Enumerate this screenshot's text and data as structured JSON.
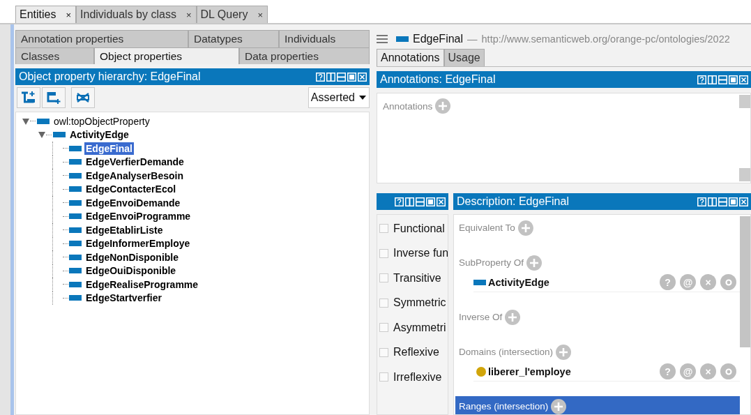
{
  "workspace_tabs": [
    {
      "label": "Entities",
      "close": "×",
      "selected": true
    },
    {
      "label": "Individuals by class",
      "close": "×",
      "selected": false
    },
    {
      "label": "DL Query",
      "close": "×",
      "selected": false
    }
  ],
  "entity_tabs": [
    [
      {
        "label": "Annotation properties",
        "selected": false
      },
      {
        "label": "Datatypes",
        "selected": false
      },
      {
        "label": "Individuals",
        "selected": false
      }
    ],
    [
      {
        "label": "Classes",
        "selected": false
      },
      {
        "label": "Object properties",
        "selected": true
      },
      {
        "label": "Data properties",
        "selected": false
      }
    ]
  ],
  "hierarchy": {
    "title": "Object property hierarchy: EdgeFinal",
    "view_mode": "Asserted",
    "tree": [
      {
        "label": "owl:topObjectProperty",
        "expanded": true,
        "selected": false,
        "children": [
          {
            "label": "ActivityEdge",
            "expanded": true,
            "selected": false,
            "children": [
              {
                "label": "EdgeFinal",
                "selected": true
              },
              {
                "label": "EdgeVerfierDemande",
                "selected": false
              },
              {
                "label": "EdgeAnalyserBesoin",
                "selected": false
              },
              {
                "label": "EdgeContacterEcol",
                "selected": false
              },
              {
                "label": "EdgeEnvoiDemande",
                "selected": false
              },
              {
                "label": "EdgeEnvoiProgramme",
                "selected": false
              },
              {
                "label": "EdgeEtablirListe",
                "selected": false
              },
              {
                "label": "EdgeInformerEmploye",
                "selected": false
              },
              {
                "label": "EdgeNonDisponible",
                "selected": false
              },
              {
                "label": "EdgeOuiDisponible",
                "selected": false
              },
              {
                "label": "EdgeRealiseProgramme",
                "selected": false
              },
              {
                "label": "EdgeStartverfier",
                "selected": false
              }
            ]
          }
        ]
      }
    ]
  },
  "entity_header": {
    "name": "EdgeFinal",
    "separator": "—",
    "iri": "http://www.semanticweb.org/orange-pc/ontologies/2022"
  },
  "detail_tabs": [
    {
      "label": "Annotations",
      "selected": true
    },
    {
      "label": "Usage",
      "selected": false
    }
  ],
  "annotations_view": {
    "title": "Annotations: EdgeFinal",
    "section": "Annotations"
  },
  "characteristics_view": {
    "items": [
      {
        "label": "Functional",
        "checked": false
      },
      {
        "label": "Inverse fun",
        "checked": false
      },
      {
        "label": "Transitive",
        "checked": false
      },
      {
        "label": "Symmetric",
        "checked": false
      },
      {
        "label": "Asymmetri",
        "checked": false
      },
      {
        "label": "Reflexive",
        "checked": false
      },
      {
        "label": "Irreflexive",
        "checked": false
      }
    ]
  },
  "description_view": {
    "title": "Description: EdgeFinal",
    "sections": [
      {
        "label": "Equivalent To",
        "selected": false
      },
      {
        "label": "SubProperty Of",
        "selected": false,
        "items": [
          {
            "label": "ActivityEdge",
            "kind": "property",
            "actions": [
              "?",
              "@",
              "×"
            ]
          }
        ]
      },
      {
        "label": "Inverse Of",
        "selected": false
      },
      {
        "label": "Domains (intersection)",
        "selected": false,
        "items": [
          {
            "label": "liberer_l'employe",
            "kind": "class",
            "actions": [
              "?",
              "@",
              "×"
            ]
          }
        ]
      },
      {
        "label": "Ranges (intersection)",
        "selected": true
      }
    ]
  }
}
